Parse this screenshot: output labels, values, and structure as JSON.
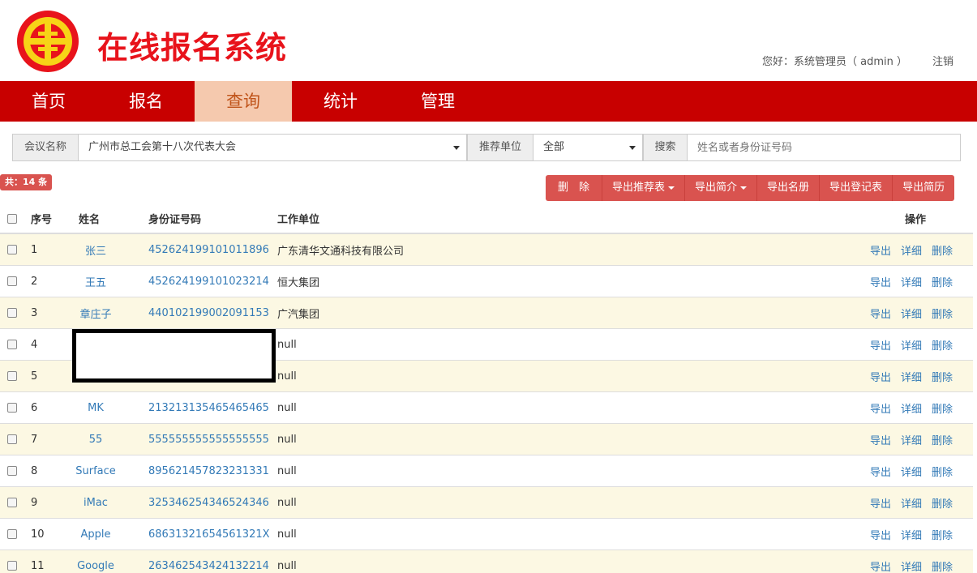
{
  "header": {
    "app_title": "在线报名系统",
    "greeting": "您好：系统管理员（ admin ）",
    "logout": "注销"
  },
  "nav": {
    "items": [
      {
        "label": "首页"
      },
      {
        "label": "报名"
      },
      {
        "label": "查询"
      },
      {
        "label": "统计"
      },
      {
        "label": "管理"
      }
    ],
    "active": "查询"
  },
  "search": {
    "meeting_label": "会议名称",
    "meeting_value": "广州市总工会第十八次代表大会",
    "unit_label": "推荐单位",
    "unit_value": "全部",
    "search_label": "搜索",
    "search_placeholder": "姓名或者身份证号码"
  },
  "count_badge": "共：14 条",
  "toolbar": {
    "delete": "删　除",
    "export_recommend": "导出推荐表",
    "export_brief": "导出简介",
    "export_roster": "导出名册",
    "export_register": "导出登记表",
    "export_resume": "导出简历"
  },
  "table": {
    "headers": {
      "no": "序号",
      "name": "姓名",
      "id": "身份证号码",
      "unit": "工作单位",
      "ops": "操作"
    },
    "op_labels": {
      "export": "导出",
      "detail": "详细",
      "delete": "删除"
    },
    "rows": [
      {
        "no": "1",
        "name": "张三",
        "id": "452624199101011896",
        "unit": "广东清华文通科技有限公司"
      },
      {
        "no": "2",
        "name": "王五",
        "id": "452624199101023214",
        "unit": "恒大集团"
      },
      {
        "no": "3",
        "name": "章庄子",
        "id": "440102199002091153",
        "unit": "广汽集团"
      },
      {
        "no": "4",
        "name": "",
        "id": "",
        "unit": "null"
      },
      {
        "no": "5",
        "name": "",
        "id": "",
        "unit": "null"
      },
      {
        "no": "6",
        "name": "MK",
        "id": "213213135465465465",
        "unit": "null"
      },
      {
        "no": "7",
        "name": "55",
        "id": "555555555555555555",
        "unit": "null"
      },
      {
        "no": "8",
        "name": "Surface",
        "id": "895621457823231331",
        "unit": "null"
      },
      {
        "no": "9",
        "name": "iMac",
        "id": "325346254346524346",
        "unit": "null"
      },
      {
        "no": "10",
        "name": "Apple",
        "id": "68631321654561321X",
        "unit": "null"
      },
      {
        "no": "11",
        "name": "Google",
        "id": "263462543424132214",
        "unit": "null"
      }
    ]
  },
  "colors": {
    "brand_red": "#c80000",
    "title_red": "#e8131b",
    "active_tab": "#f5c9ae",
    "link": "#337ab7",
    "button_red": "#d9534f",
    "stripe": "#fcf8e3"
  }
}
